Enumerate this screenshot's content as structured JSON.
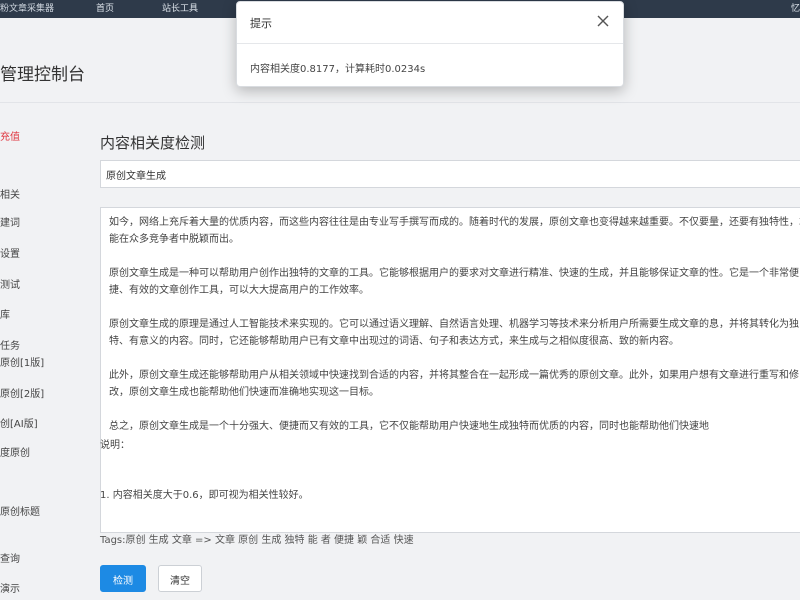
{
  "topbar": {
    "brand": "粉文章采集器",
    "nav": [
      "首页",
      "站长工具"
    ],
    "user": "忆"
  },
  "header": {
    "title": "管理控制台"
  },
  "sidebar": {
    "items": [
      {
        "label": "充值",
        "active": true
      },
      {
        "label": "相关"
      },
      {
        "label": "建词"
      },
      {
        "label": "设置"
      },
      {
        "label": "测试"
      },
      {
        "label": "库"
      },
      {
        "label": "任务"
      },
      {
        "label": "原创[1版]"
      },
      {
        "label": "原创[2版]"
      },
      {
        "label": "创[AI版]"
      },
      {
        "label": "度原创"
      },
      {
        "label": "原创标题"
      },
      {
        "label": "查询"
      },
      {
        "label": "演示"
      }
    ]
  },
  "main": {
    "section_title": "内容相关度检测",
    "title_value": "原创文章生成",
    "content_paragraphs": [
      "如今，网络上充斥着大量的优质内容，而这些内容往往是由专业写手撰写而成的。随着时代的发展，原创文章也变得越来越重要。不仅要量，还要有独特性，才能在众多竞争者中脱颖而出。",
      "原创文章生成是一种可以帮助用户创作出独特的文章的工具。它能够根据用户的要求对文章进行精准、快速的生成，并且能够保证文章的性。它是一个非常便捷、有效的文章创作工具，可以大大提高用户的工作效率。",
      "原创文章生成的原理是通过人工智能技术来实现的。它可以通过语义理解、自然语言处理、机器学习等技术来分析用户所需要生成文章的息，并将其转化为独特、有意义的内容。同时，它还能够帮助用户已有文章中出现过的词语、句子和表达方式，来生成与之相似度很高、致的新内容。",
      "此外，原创文章生成还能够帮助用户从相关领域中快速找到合适的内容，并将其整合在一起形成一篇优秀的原创文章。此外，如果用户想有文章进行重写和修改，原创文章生成也能帮助他们快速而准确地实现这一目标。",
      "总之，原创文章生成是一个十分强大、便捷而又有效的工具，它不仅能帮助用户快速地生成独特而优质的内容，同时也能帮助他们快速地"
    ],
    "note_label": "说明：",
    "note_item": "1. 内容相关度大于0.6，即可视为相关性较好。",
    "tags": "Tags:原创 生成 文章 => 文章 原创 生成 独特 能 者 便捷 颖 合适 快速",
    "detect_button": "检测",
    "clear_button": "清空"
  },
  "dialog": {
    "title": "提示",
    "message": "内容相关度0.8177，计算耗时0.0234s"
  }
}
